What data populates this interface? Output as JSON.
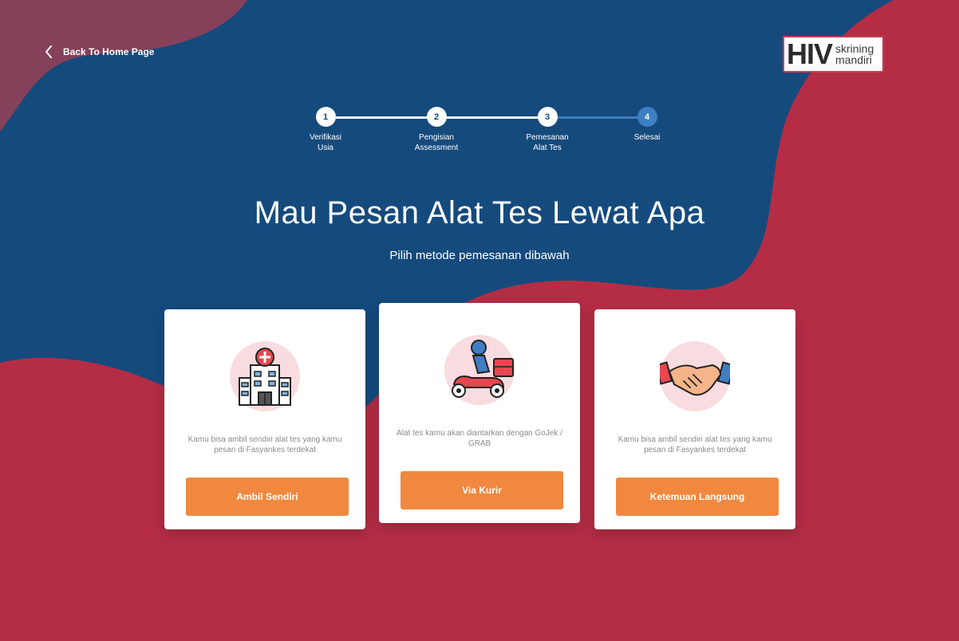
{
  "nav": {
    "back_label": "Back To Home Page"
  },
  "logo": {
    "main": "HIV",
    "line1": "skrining",
    "line2": "mandiri"
  },
  "steps": [
    {
      "number": "1",
      "label": "Verifikasi\nUsia"
    },
    {
      "number": "2",
      "label": "Pengisian\nAssessment"
    },
    {
      "number": "3",
      "label": "Pemesanan\nAlat Tes"
    },
    {
      "number": "4",
      "label": "Selesai"
    }
  ],
  "heading": {
    "title": "Mau Pesan Alat Tes Lewat Apa",
    "subtitle": "Pilih metode pemesanan dibawah"
  },
  "options": [
    {
      "icon": "hospital-icon",
      "description": "Kamu bisa ambil sendiri alat tes yang kamu pesan di Fasyankes terdekat",
      "button": "Ambil Sendiri"
    },
    {
      "icon": "courier-scooter-icon",
      "description": "Alat tes kamu akan diantarkan dengan GoJek / GRAB",
      "button": "Via Kurir"
    },
    {
      "icon": "handshake-icon",
      "description": "Kamu bisa ambil sendiri alat tes yang kamu pesan di Fasyankes terdekat",
      "button": "Ketemuan Langsung"
    }
  ],
  "colors": {
    "navy": "#154a7d",
    "crimson": "#b42d45",
    "accent_orange": "#f0883f",
    "step_active": "#3f7ec3"
  }
}
